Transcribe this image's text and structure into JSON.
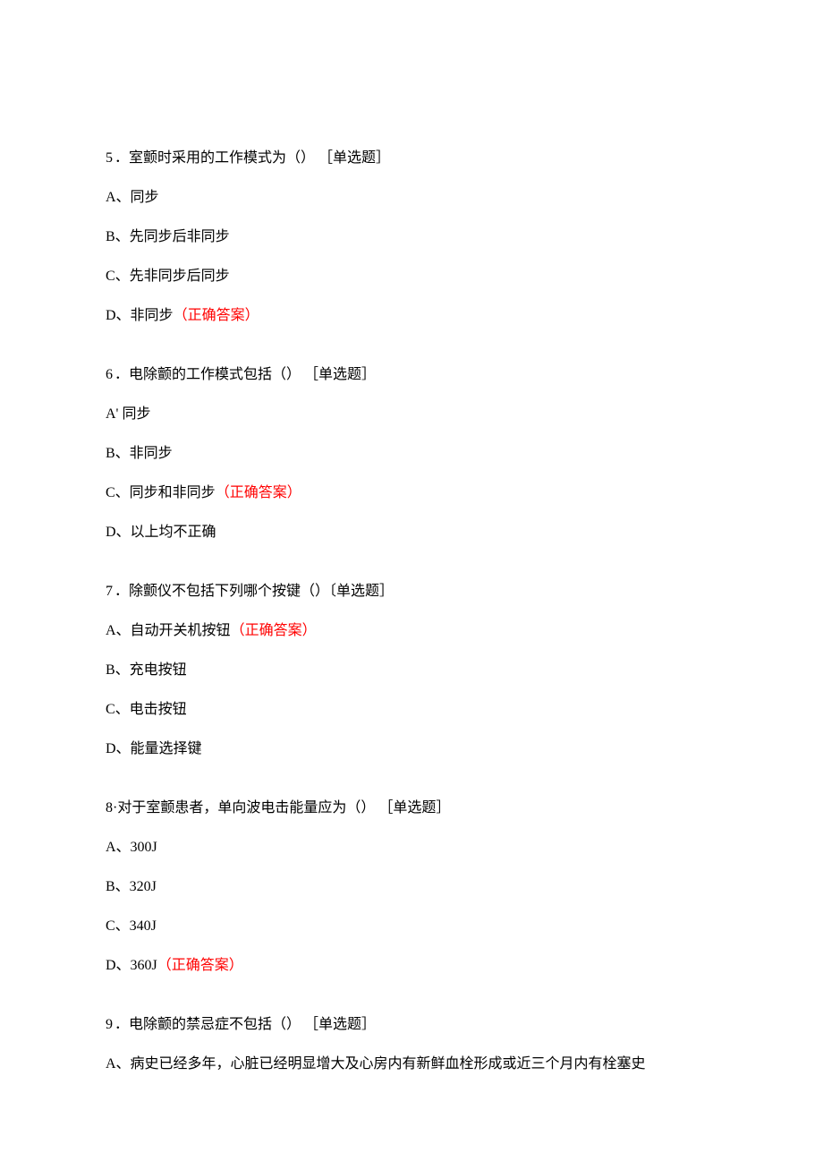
{
  "questions": [
    {
      "number": "5",
      "text": "．室颤时采用的工作模式为（） ［单选题］",
      "options": [
        {
          "label": "A、同步",
          "correct": false
        },
        {
          "label": "B、先同步后非同步",
          "correct": false
        },
        {
          "label": "C、先非同步后同步",
          "correct": false
        },
        {
          "label": "D、非同步",
          "correct": true
        }
      ]
    },
    {
      "number": "6",
      "text": "．电除颤的工作模式包括（） ［单选题］",
      "options": [
        {
          "label": "A' 同步",
          "correct": false
        },
        {
          "label": "B、非同步",
          "correct": false
        },
        {
          "label": "C、同步和非同步",
          "correct": true
        },
        {
          "label": "D、以上均不正确",
          "correct": false
        }
      ]
    },
    {
      "number": "7",
      "text": "．除颤仪不包括下列哪个按键（）〔单选题］",
      "options": [
        {
          "label": "A、自动开关机按钮",
          "correct": true
        },
        {
          "label": "B、充电按钮",
          "correct": false
        },
        {
          "label": "C、电击按钮",
          "correct": false
        },
        {
          "label": "D、能量选择键",
          "correct": false
        }
      ]
    },
    {
      "number": "8",
      "text": "·对于室颤患者，单向波电击能量应为（） ［单选题］",
      "options": [
        {
          "label": "A、300J",
          "correct": false
        },
        {
          "label": "B、320J",
          "correct": false
        },
        {
          "label": "C、340J",
          "correct": false
        },
        {
          "label": "D、360J",
          "correct": true
        }
      ]
    },
    {
      "number": "9",
      "text": "．电除颤的禁忌症不包括（） ［单选题］",
      "options": [
        {
          "label": "A、病史已经多年，心脏已经明显增大及心房内有新鲜血栓形成或近三个月内有栓塞史",
          "correct": false
        }
      ]
    }
  ],
  "correct_marker": "（正确答案）"
}
